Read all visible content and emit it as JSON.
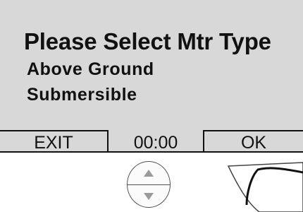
{
  "screen": {
    "title": "Please Select Mtr Type",
    "options": [
      {
        "label": "Above Ground"
      },
      {
        "label": "Submersible"
      }
    ]
  },
  "softkeys": {
    "exit_label": "EXIT",
    "time_display": "00:00",
    "ok_label": "OK"
  },
  "controls": {
    "up_icon": "triangle-up-icon",
    "down_icon": "triangle-down-icon",
    "ok_icon": "check-swoosh-icon"
  },
  "colors": {
    "lcd_background": "#d8d8d8",
    "text": "#111111",
    "arrow_fill": "#9a9a9a"
  }
}
